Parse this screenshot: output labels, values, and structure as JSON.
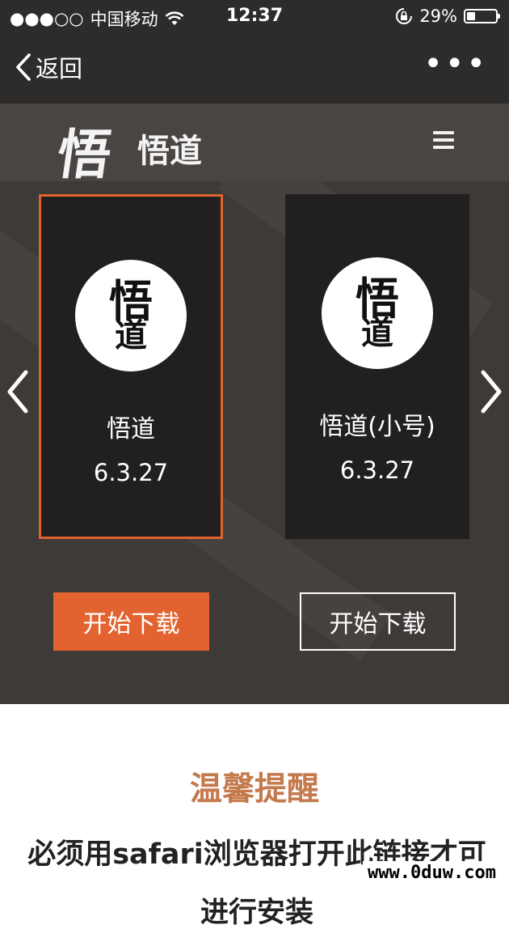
{
  "status_bar": {
    "signal": "●●●○○",
    "carrier": "中国移动",
    "time": "12:37",
    "battery_percent": "29%",
    "battery_level": 0.29
  },
  "nav": {
    "back_label": "返回",
    "more_label": "•••"
  },
  "brand": {
    "logo_glyph": "悟",
    "name": "悟道"
  },
  "apps": [
    {
      "logo_top": "悟",
      "logo_bottom": "道",
      "name": "悟道",
      "version": "6.3.27",
      "download_label": "开始下载",
      "selected": true
    },
    {
      "logo_top": "悟",
      "logo_bottom": "道",
      "name": "悟道(小号)",
      "version": "6.3.27",
      "download_label": "开始下载",
      "selected": false
    }
  ],
  "tip": {
    "title": "温馨提醒",
    "body": "必须用safari浏览器打开此链接才可进行安装"
  },
  "watermark": "www.0duw.com",
  "colors": {
    "accent": "#e2632f",
    "tip_title": "#c57a4d",
    "header_bg": "#2e2c2b",
    "brand_bg": "#4a4542",
    "gallery_bg": "#3d3a38",
    "card_bg": "#221f20"
  }
}
